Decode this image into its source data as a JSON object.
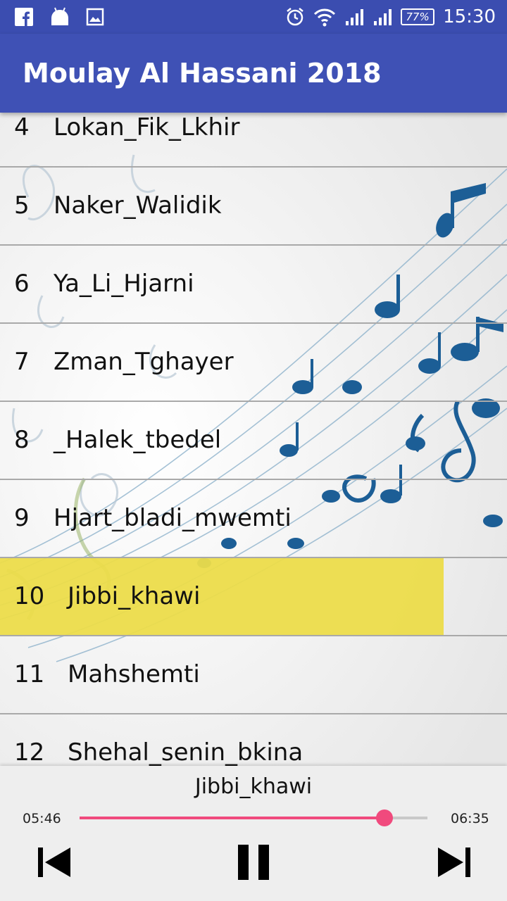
{
  "status_bar": {
    "time": "15:30",
    "battery": "77%",
    "left_icons": [
      "facebook-icon",
      "android-icon",
      "image-icon"
    ],
    "right_icons": [
      "alarm-icon",
      "wifi-icon",
      "signal-icon",
      "signal-icon"
    ]
  },
  "app_bar": {
    "title": "Moulay Al Hassani 2018"
  },
  "tracks": [
    {
      "num": "4",
      "name": "Lokan_Fik_Lkhir"
    },
    {
      "num": "5",
      "name": "Naker_Walidik"
    },
    {
      "num": "6",
      "name": "Ya_Li_Hjarni"
    },
    {
      "num": "7",
      "name": "Zman_Tghayer"
    },
    {
      "num": "8",
      "name": "_Halek_tbedel"
    },
    {
      "num": "9",
      "name": "Hjart_bladi_mwemti"
    },
    {
      "num": "10",
      "name": "Jibbi_khawi"
    },
    {
      "num": "11",
      "name": "Mahshemti"
    },
    {
      "num": "12",
      "name": "Shehal_senin_bkina"
    }
  ],
  "active_track_index": 6,
  "player": {
    "now_playing": "Jibbi_khawi",
    "elapsed": "05:46",
    "total": "06:35",
    "progress": 0.876
  },
  "colors": {
    "status_bar": "#3b4db0",
    "app_bar": "#3f51b5",
    "highlight": "#ecdc4a",
    "seek_accent": "#f04a7d",
    "notes": "#1c5e96"
  },
  "icons": {
    "prev": "skip-previous-icon",
    "pause": "pause-icon",
    "next": "skip-next-icon"
  }
}
